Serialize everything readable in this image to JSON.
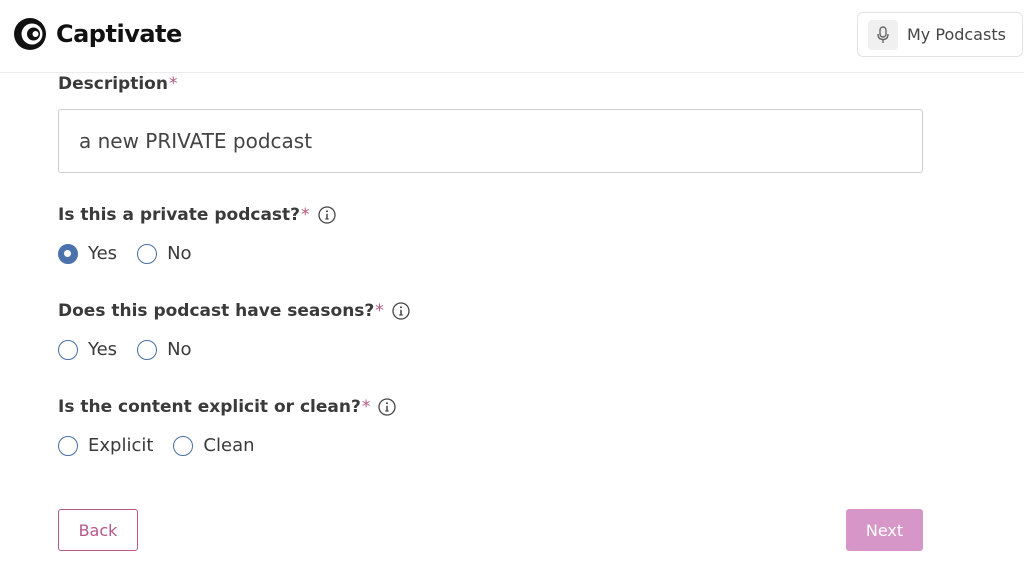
{
  "header": {
    "brand": "Captivate",
    "my_podcasts_label": "My Podcasts"
  },
  "form": {
    "description": {
      "label": "Description",
      "required_mark": "*",
      "value": "a new PRIVATE podcast"
    },
    "private": {
      "label": "Is this a private podcast?",
      "required_mark": "*",
      "options": [
        "Yes",
        "No"
      ],
      "selected": "Yes"
    },
    "seasons": {
      "label": "Does this podcast have seasons?",
      "required_mark": "*",
      "options": [
        "Yes",
        "No"
      ],
      "selected": null
    },
    "explicit": {
      "label": "Is the content explicit or clean?",
      "required_mark": "*",
      "options": [
        "Explicit",
        "Clean"
      ],
      "selected": null
    }
  },
  "buttons": {
    "back_label": "Back",
    "next_label": "Next"
  },
  "colors": {
    "accent": "#b5578a",
    "next_disabled": "#d796c8",
    "radio_checked": "#4a72ad",
    "required": "#b5577f"
  },
  "icons": {
    "logo": "captivate-logo-icon",
    "mic": "microphone-icon",
    "info": "info-icon"
  }
}
